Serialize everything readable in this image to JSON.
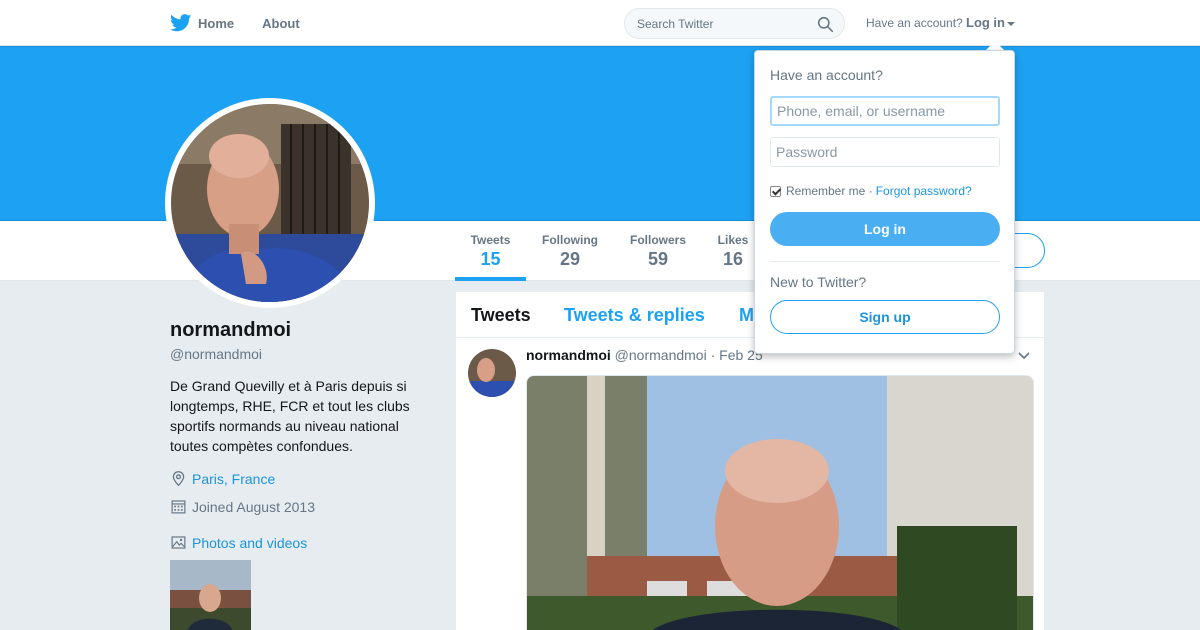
{
  "nav": {
    "home_label": "Home",
    "about_label": "About",
    "search_placeholder": "Search Twitter",
    "have_account_text": "Have an account?",
    "login_label": "Log in",
    "brand_color": "#1da1f2"
  },
  "profile": {
    "name": "normandmoi",
    "handle": "@normandmoi",
    "bio": "De Grand Quevilly et à Paris depuis si longtemps, RHE, FCR et tout les clubs sportifs normands au niveau national toutes compètes confondues.",
    "location": "Paris, France",
    "joined": "Joined August 2013",
    "photos_label": "Photos and videos"
  },
  "stats": [
    {
      "label": "Tweets",
      "value": "15"
    },
    {
      "label": "Following",
      "value": "29"
    },
    {
      "label": "Followers",
      "value": "59"
    },
    {
      "label": "Likes",
      "value": "16"
    }
  ],
  "timeline": {
    "tabs": [
      "Tweets",
      "Tweets & replies",
      "M"
    ],
    "tweet": {
      "name": "normandmoi",
      "handle": "@normandmoi",
      "date": "· Feb 25"
    }
  },
  "login_dropdown": {
    "title": "Have an account?",
    "username_placeholder": "Phone, email, or username",
    "password_placeholder": "Password",
    "remember_label": "Remember me ·",
    "forgot_label": "Forgot password?",
    "login_button": "Log in",
    "new_title": "New to Twitter?",
    "signup_button": "Sign up"
  }
}
